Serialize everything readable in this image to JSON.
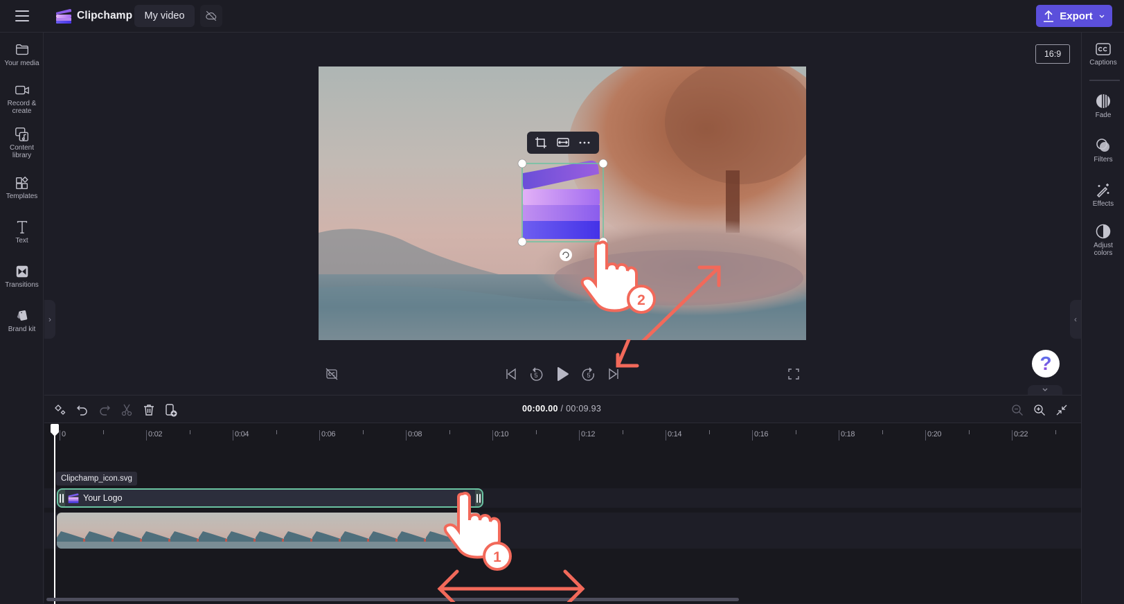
{
  "header": {
    "app_name": "Clipchamp",
    "project_name": "My video",
    "export_label": "Export",
    "icons": {
      "menu": "hamburger-icon",
      "cloud": "cloud-off-icon",
      "export": "upload-icon",
      "export_chevron": "chevron-down-icon"
    }
  },
  "left_sidebar": {
    "items": [
      {
        "label": "Your media",
        "icon": "folder-icon"
      },
      {
        "label": "Record & create",
        "icon": "camera-icon"
      },
      {
        "label": "Content library",
        "icon": "content-library-icon"
      },
      {
        "label": "Templates",
        "icon": "templates-icon"
      },
      {
        "label": "Text",
        "icon": "text-icon"
      },
      {
        "label": "Transitions",
        "icon": "transitions-icon"
      },
      {
        "label": "Brand kit",
        "icon": "brand-kit-icon"
      }
    ],
    "expand_handle": "›"
  },
  "right_sidebar": {
    "items": [
      {
        "label": "Captions",
        "icon": "captions-icon"
      },
      {
        "label": "Fade",
        "icon": "fade-icon"
      },
      {
        "label": "Filters",
        "icon": "filters-icon"
      },
      {
        "label": "Effects",
        "icon": "effects-icon"
      },
      {
        "label": "Adjust colors",
        "icon": "adjust-colors-icon"
      }
    ],
    "collapse_handle": "‹"
  },
  "preview": {
    "aspect_ratio": "16:9",
    "context_toolbar": [
      "crop-icon",
      "fit-icon",
      "more-icon"
    ],
    "selected_element": "Clipchamp logo",
    "annotation_step": "2"
  },
  "playback": {
    "buttons": [
      "captions-off-icon",
      "skip-back-icon",
      "rewind-5-icon",
      "play-icon",
      "forward-5-icon",
      "skip-forward-icon",
      "fullscreen-icon"
    ],
    "rewind_seconds": "5",
    "forward_seconds": "5"
  },
  "help": {
    "label": "?"
  },
  "timeline": {
    "toolbar": [
      "magic-edit-icon",
      "undo-icon",
      "redo-icon",
      "split-icon",
      "delete-icon",
      "add-to-library-icon"
    ],
    "current_time": "00:00.00",
    "separator": " / ",
    "total_time": "00:09.93",
    "zoom_controls": [
      "zoom-out-icon",
      "zoom-in-icon",
      "fit-timeline-icon"
    ],
    "ruler_labels": [
      "0",
      "0:02",
      "0:04",
      "0:06",
      "0:08",
      "0:10",
      "0:12",
      "0:14",
      "0:16",
      "0:18",
      "0:20",
      "0:22"
    ],
    "clip_tooltip": "Clipchamp_icon.svg",
    "logo_clip_name": "Your Logo",
    "annotation_step": "1"
  },
  "colors": {
    "accent": "#5b4fdb",
    "selection": "#6ac3a2",
    "annotation": "#f2695a"
  }
}
